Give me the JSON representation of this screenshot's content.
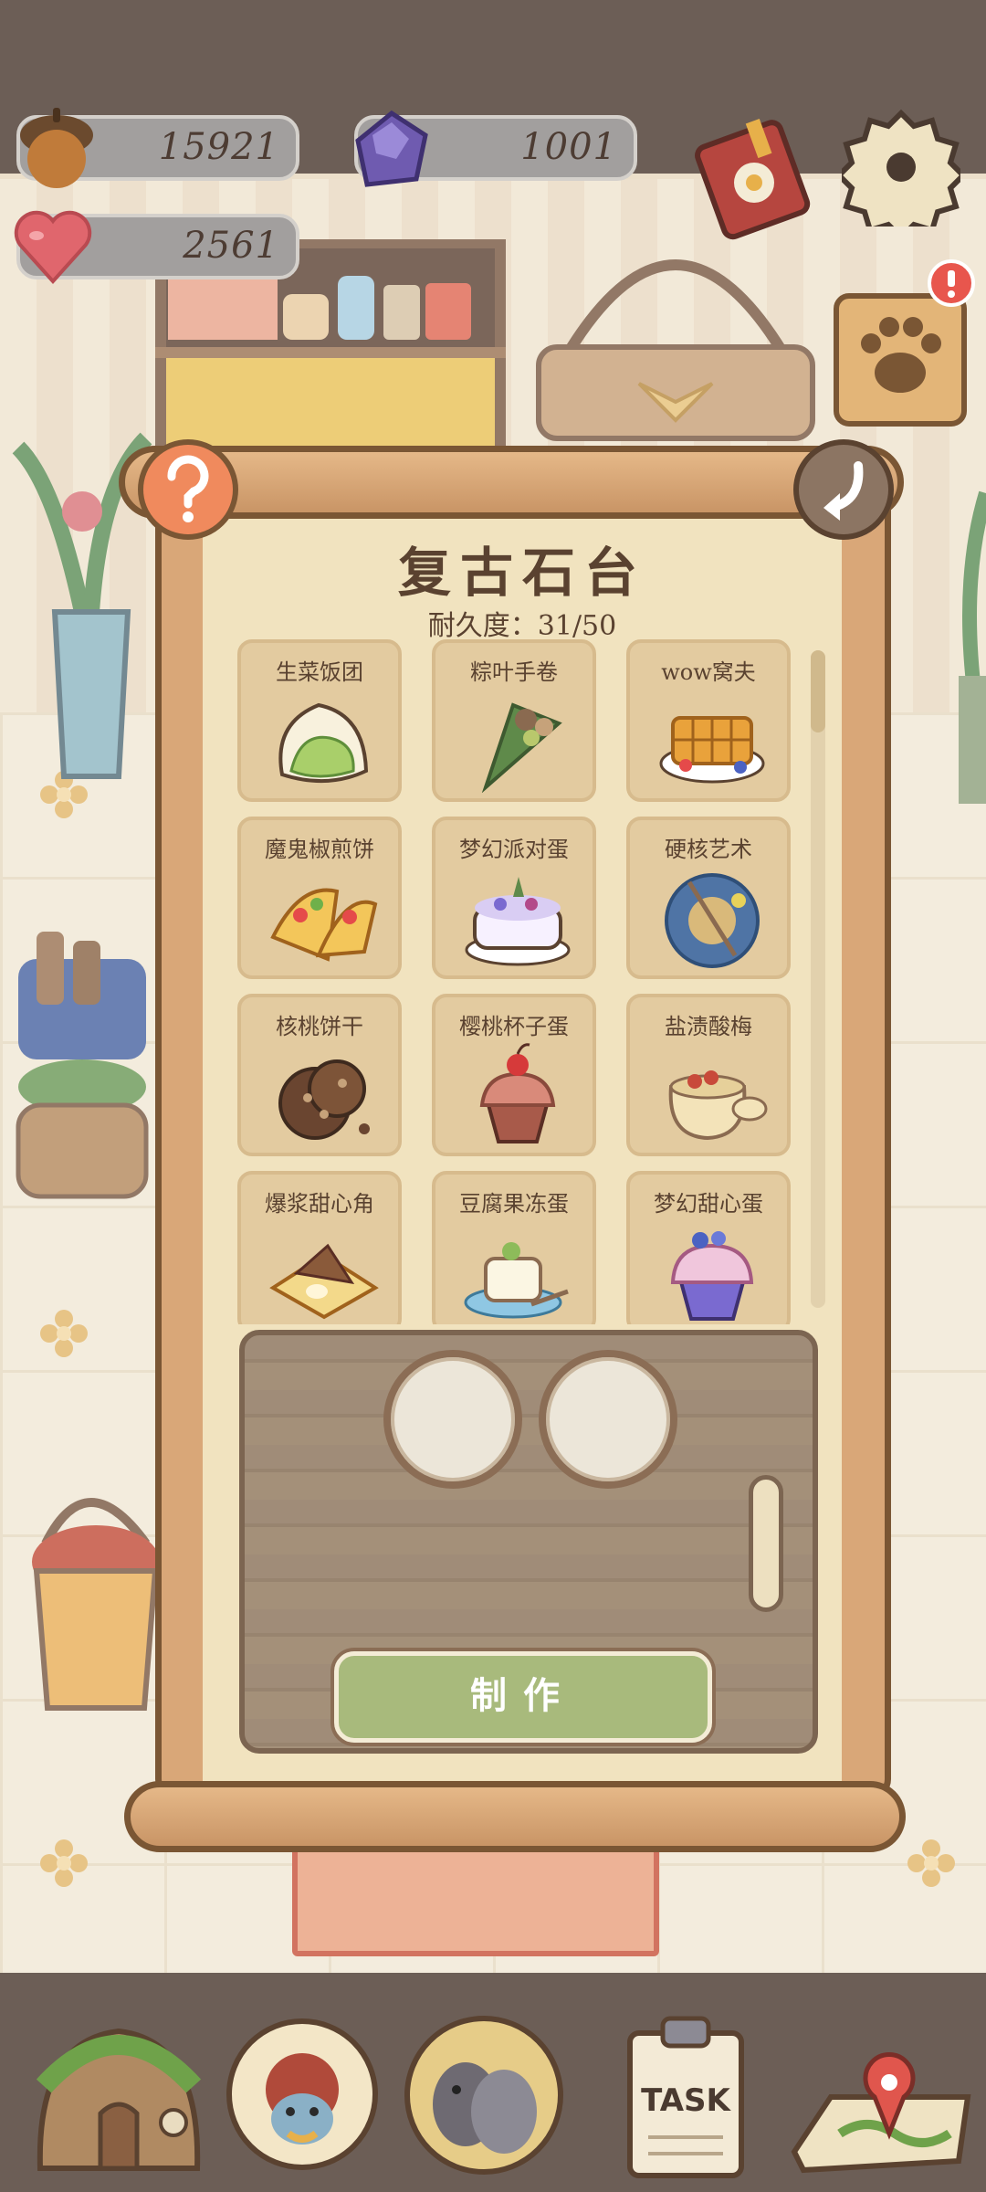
{
  "resources": {
    "acorns": "15921",
    "gems": "1001",
    "hearts": "2561"
  },
  "panel": {
    "title": "复古石台",
    "durability": "耐久度：31/50",
    "make_button": "制作"
  },
  "recipes": [
    {
      "label": "生菜饭团",
      "icon": "rice-ball-icon"
    },
    {
      "label": "粽叶手卷",
      "icon": "leaf-roll-icon"
    },
    {
      "label": "wow窝夫",
      "icon": "waffle-icon"
    },
    {
      "label": "魔鬼椒煎饼",
      "icon": "taco-icon"
    },
    {
      "label": "梦幻派对蛋",
      "icon": "party-cake-icon"
    },
    {
      "label": "硬核艺术",
      "icon": "art-plate-icon"
    },
    {
      "label": "核桃饼干",
      "icon": "walnut-cookie-icon"
    },
    {
      "label": "樱桃杯子蛋",
      "icon": "cherry-cupcake-icon"
    },
    {
      "label": "盐渍酸梅",
      "icon": "pickled-plum-jar-icon"
    },
    {
      "label": "爆浆甜心角",
      "icon": "sweet-dumpling-icon"
    },
    {
      "label": "豆腐果冻蛋",
      "icon": "tofu-pudding-icon"
    },
    {
      "label": "梦幻甜心蛋",
      "icon": "dream-cupcake-icon"
    }
  ],
  "nav": {
    "task_label": "TASK"
  },
  "colors": {
    "paper": "#f1e3bf",
    "frame": "#d9a778",
    "make_button": "#a8ba7c",
    "text": "#5a4230"
  }
}
